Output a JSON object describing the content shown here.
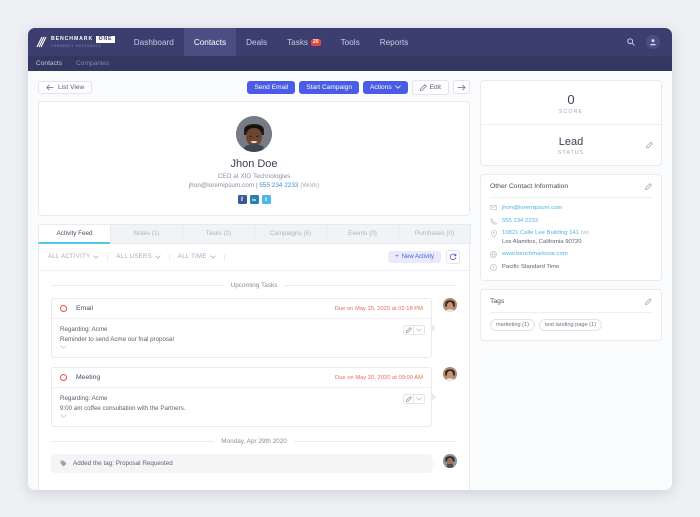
{
  "nav": {
    "logo": {
      "main": "BENCHMARK",
      "badge": "ONE",
      "sub": "FORMERLY HATCHBUCK"
    },
    "items": [
      {
        "label": "Dashboard",
        "active": false,
        "badge": ""
      },
      {
        "label": "Contacts",
        "active": true,
        "badge": ""
      },
      {
        "label": "Deals",
        "active": false,
        "badge": ""
      },
      {
        "label": "Tasks",
        "active": false,
        "badge": "20"
      },
      {
        "label": "Tools",
        "active": false,
        "badge": ""
      },
      {
        "label": "Reports",
        "active": false,
        "badge": ""
      }
    ],
    "search_icon": "search-icon",
    "account_icon": "user-icon"
  },
  "subnav": {
    "items": [
      {
        "label": "Contacts"
      },
      {
        "label": "Companies"
      }
    ]
  },
  "toolbar": {
    "list_view": "List View",
    "send_email": "Send Email",
    "start_campaign": "Start Campaign",
    "actions": "Actions",
    "edit": "Edit",
    "next_arrow": "→"
  },
  "profile": {
    "name": "Jhon Doe",
    "title": "CEO at XIO Technologies",
    "email": "jhon@loremipsum.com",
    "separator": " | ",
    "phone": "555 234 2233",
    "phone_type": "(Work)",
    "socials": [
      {
        "name": "facebook-icon",
        "glyph": "f",
        "color": "#3b5998"
      },
      {
        "name": "linkedin-icon",
        "glyph": "in",
        "color": "#2581b4"
      },
      {
        "name": "twitter-icon",
        "glyph": "t",
        "color": "#4fb4e8"
      }
    ]
  },
  "tabs": [
    {
      "label": "Activity Feed",
      "active": true
    },
    {
      "label": "Notes (1)",
      "active": false
    },
    {
      "label": "Tasks (2)",
      "active": false
    },
    {
      "label": "Campaigns (5)",
      "active": false
    },
    {
      "label": "Events (0)",
      "active": false
    },
    {
      "label": "Purchases (0)",
      "active": false
    }
  ],
  "filters": [
    {
      "label": "ALL ACTIVITY"
    },
    {
      "label": "ALL USERS"
    },
    {
      "label": "ALL TIME"
    }
  ],
  "feed_actions": {
    "new_activity": "New Activity",
    "refresh_icon": "refresh-icon"
  },
  "feed": {
    "upcoming_label": "Upcoming Tasks",
    "date_label": "Monday, Apr 29th 2020",
    "tasks": [
      {
        "type": "Email",
        "due": "Due on May 15, 2020 at 02:18 PM",
        "regarding": "Regarding: Acme",
        "detail": "Reminder to send Acme our fnal proposal"
      },
      {
        "type": "Meeting",
        "due": "Due on May 20, 2020 at 09:00 AM",
        "regarding": "Regarding: Acme",
        "detail": "9:00 am coffee consultation with the Partners."
      }
    ],
    "event": {
      "text": "Added the tag: Proposal Requested",
      "icon": "tag-icon"
    }
  },
  "score": {
    "value": "0",
    "label": "SCORE"
  },
  "status": {
    "value": "Lead",
    "label": "STATUS"
  },
  "contact_info": {
    "heading": "Other Contact Information",
    "rows": [
      {
        "icon": "mail-icon",
        "text": "jhon@loremipsum.com",
        "style": "link",
        "extra": "",
        "second": ""
      },
      {
        "icon": "phone-icon",
        "text": "555 234 2233",
        "style": "link",
        "extra": "",
        "second": ""
      },
      {
        "icon": "pin-icon",
        "text": "10821 Calle Lee Building 141",
        "style": "link",
        "extra": "(w)",
        "second": "Los Alamitos, California 90720"
      },
      {
        "icon": "globe-icon",
        "text": "www.benchmarkone.com",
        "style": "link",
        "extra": "",
        "second": ""
      },
      {
        "icon": "clock-icon",
        "text": "Pacific Standard Time",
        "style": "plain",
        "extra": "",
        "second": ""
      }
    ]
  },
  "tags": {
    "heading": "Tags",
    "chips": [
      {
        "label": "marketing (1)"
      },
      {
        "label": "test landing page (1)"
      }
    ]
  },
  "colors": {
    "nav_bg": "#3b3e6e",
    "primary": "#4b5ce4",
    "accent_cyan": "#53c6e8",
    "danger": "#ef4a4a",
    "link": "#4fb4e0"
  }
}
